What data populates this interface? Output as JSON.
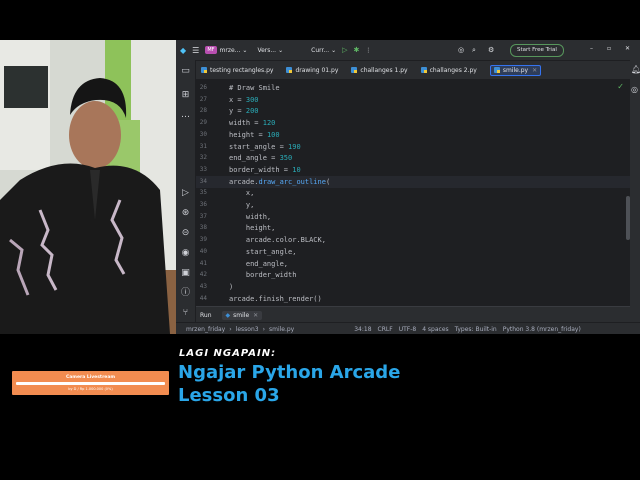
{
  "titlebar": {
    "project_badge": "MF",
    "project": "mrze...",
    "vcs": "Vers...",
    "run_config": "Curr...",
    "trial_button": "Start Free Trial"
  },
  "tabs": [
    {
      "label": "testing rectangles.py",
      "active": false
    },
    {
      "label": "drawing 01.py",
      "active": false
    },
    {
      "label": "challanges 1.py",
      "active": false
    },
    {
      "label": "challanges 2.py",
      "active": false
    },
    {
      "label": "smile.py",
      "active": true
    }
  ],
  "code_lines": [
    {
      "num": "26",
      "text": "# Draw Smile",
      "kind": "comment"
    },
    {
      "num": "27",
      "text": "x = 300",
      "kind": "assign",
      "var": "x",
      "val": "300"
    },
    {
      "num": "28",
      "text": "y = 200",
      "kind": "assign",
      "var": "y",
      "val": "200"
    },
    {
      "num": "29",
      "text": "width = 120",
      "kind": "assign",
      "var": "width",
      "val": "120"
    },
    {
      "num": "30",
      "text": "height = 100",
      "kind": "assign",
      "var": "height",
      "val": "100"
    },
    {
      "num": "31",
      "text": "start_angle = 190",
      "kind": "assign",
      "var": "start_angle",
      "val": "190"
    },
    {
      "num": "32",
      "text": "end_angle = 350",
      "kind": "assign",
      "var": "end_angle",
      "val": "350"
    },
    {
      "num": "33",
      "text": "border_width = 10",
      "kind": "assign",
      "var": "border_width",
      "val": "10"
    },
    {
      "num": "34",
      "text": "arcade.draw_arc_outline(",
      "kind": "call",
      "current": true
    },
    {
      "num": "35",
      "text": "    x,",
      "kind": "plain"
    },
    {
      "num": "36",
      "text": "    y,",
      "kind": "plain"
    },
    {
      "num": "37",
      "text": "    width,",
      "kind": "plain"
    },
    {
      "num": "38",
      "text": "    height,",
      "kind": "plain"
    },
    {
      "num": "39",
      "text": "    arcade.color.BLACK,",
      "kind": "plain"
    },
    {
      "num": "40",
      "text": "    start_angle,",
      "kind": "plain"
    },
    {
      "num": "41",
      "text": "    end_angle,",
      "kind": "plain"
    },
    {
      "num": "42",
      "text": "    border_width",
      "kind": "plain"
    },
    {
      "num": "43",
      "text": ")",
      "kind": "plain"
    },
    {
      "num": "44",
      "text": "arcade.finish_render()",
      "kind": "plain"
    }
  ],
  "runbar": {
    "label": "Run",
    "tab": "smile"
  },
  "status": {
    "breadcrumb": [
      "mrzen_friday",
      "lesson3",
      "smile.py"
    ],
    "position": "34:18",
    "line_sep": "CRLF",
    "encoding": "UTF-8",
    "indent": "4 spaces",
    "types": "Types: Built-in",
    "interpreter": "Python 3.8 (mrzen_friday)"
  },
  "overlay": {
    "livestream_title": "Camera Livestream",
    "livestream_sub": "by D / Rp 1.000.000 (0%)",
    "lagi": "LAGI NGAPAIN:",
    "heading_line1": "Ngajar Python Arcade",
    "heading_line2": "Lesson 03"
  },
  "colors": {
    "accent_blue": "#2aa6e8",
    "livestream_orange": "#f28c50",
    "ide_bg": "#1e1f22"
  }
}
